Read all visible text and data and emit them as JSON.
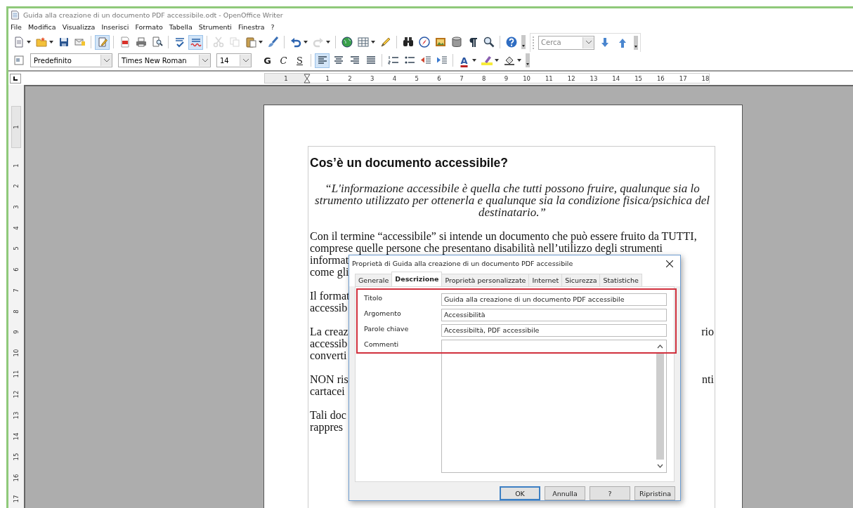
{
  "window": {
    "title": "Guida alla creazione di un documento PDF accessibile.odt - OpenOffice Writer"
  },
  "menu": [
    "File",
    "Modifica",
    "Visualizza",
    "Inserisci",
    "Formato",
    "Tabella",
    "Strumenti",
    "Finestra",
    "?"
  ],
  "standard_toolbar": {
    "buttons": [
      {
        "pressed": false,
        "disabled": false
      },
      {
        "pressed": false,
        "disabled": false
      },
      {
        "pressed": false,
        "disabled": false
      },
      {
        "pressed": false,
        "disabled": false
      },
      {
        "pressed": true,
        "disabled": false
      },
      {
        "pressed": false,
        "disabled": false
      },
      {
        "pressed": false,
        "disabled": false
      },
      {
        "pressed": false,
        "disabled": false
      },
      {
        "pressed": false,
        "disabled": false
      },
      {
        "pressed": true,
        "disabled": false
      },
      {
        "pressed": false,
        "disabled": true
      },
      {
        "pressed": false,
        "disabled": true
      },
      {
        "pressed": false,
        "disabled": false
      },
      {
        "pressed": false,
        "disabled": false
      },
      {
        "pressed": false,
        "disabled": false
      },
      {
        "pressed": false,
        "disabled": true
      },
      {
        "pressed": false,
        "disabled": false
      },
      {
        "pressed": false,
        "disabled": false
      },
      {
        "pressed": false,
        "disabled": false
      },
      {
        "pressed": false,
        "disabled": false
      },
      {
        "pressed": false,
        "disabled": false
      },
      {
        "pressed": false,
        "disabled": false
      },
      {
        "pressed": false,
        "disabled": false
      },
      {
        "pressed": false,
        "disabled": false
      },
      {
        "pressed": false,
        "disabled": false
      },
      {
        "pressed": false,
        "disabled": false
      }
    ],
    "search": {
      "placeholder": "Cerca"
    }
  },
  "formatting_toolbar": {
    "style": "Predefinito",
    "font": "Times New Roman",
    "size": "14",
    "text_buttons": [
      {
        "label": "G"
      },
      {
        "label": "C"
      },
      {
        "label": "S"
      }
    ],
    "buttons": [
      {
        "pressed": true
      },
      {
        "pressed": false
      },
      {
        "pressed": false
      },
      {
        "pressed": false
      },
      {
        "pressed": false
      },
      {
        "pressed": false
      },
      {
        "pressed": false
      },
      {
        "pressed": false
      }
    ],
    "font_color": {
      "label": "A"
    }
  },
  "horizontal_ruler": {
    "labels": [
      "1",
      "1",
      "2",
      "3",
      "4",
      "5",
      "6",
      "7",
      "8",
      "9",
      "10",
      "11",
      "12",
      "13",
      "14",
      "15",
      "16",
      "17",
      "18"
    ]
  },
  "vertical_ruler": {
    "labels": [
      "1",
      "1",
      "2",
      "3",
      "4",
      "5",
      "6",
      "7",
      "8",
      "9",
      "10",
      "11",
      "12",
      "13",
      "14",
      "15",
      "16",
      "17"
    ]
  },
  "document": {
    "heading": "Cos’è un documento accessibile?",
    "quote": "“L'informazione accessibile è quella che tutti possono fruire, qualunque sia lo strumento utilizzato per ottenerla e qualunque sia la condizione fisica/psichica del destinatario.”",
    "paragraphs": [
      {
        "lines": [
          {
            "text": "Con il termine “accessibile” si intende un documento che può essere fruito da TUTTI,"
          },
          {
            "text": "comprese quelle persone che presentano disabilità nell’utilizzo degli strumenti"
          },
          {
            "text": "informat"
          },
          {
            "text": "come gli"
          }
        ]
      },
      {
        "lines": [
          {
            "text": "Il format"
          },
          {
            "text": "accessib"
          }
        ]
      },
      {
        "lines": [
          {
            "text": "La creaz",
            "end": "rio"
          },
          {
            "text": "accessib"
          },
          {
            "text": "converti"
          }
        ]
      },
      {
        "lines": [
          {
            "text": "NON ris",
            "end": "nti"
          },
          {
            "text": "cartacei"
          }
        ]
      },
      {
        "lines": [
          {
            "text": "Tali doc"
          },
          {
            "text": "rappres"
          }
        ]
      }
    ]
  },
  "dialog": {
    "title": "Proprietà di Guida alla creazione di un documento PDF accessibile",
    "tabs": [
      {
        "label": "Generale",
        "selected": false
      },
      {
        "label": "Descrizione",
        "selected": true
      },
      {
        "label": "Proprietà personalizzate",
        "selected": false
      },
      {
        "label": "Internet",
        "selected": false
      },
      {
        "label": "Sicurezza",
        "selected": false
      },
      {
        "label": "Statistiche",
        "selected": false
      }
    ],
    "fields": [
      {
        "label": "Titolo",
        "value": "Guida alla creazione di un documento PDF accessibile"
      },
      {
        "label": "Argomento",
        "value": "Accessibilità"
      },
      {
        "label": "Parole chiave",
        "value": "Accessibiltà, PDF accessibile"
      }
    ],
    "comments": {
      "label": "Commenti"
    },
    "buttons": [
      {
        "label": "OK",
        "default": true
      },
      {
        "label": "Annulla",
        "default": false
      },
      {
        "label": "?",
        "default": false
      },
      {
        "label": "Ripristina",
        "default": false
      }
    ]
  }
}
